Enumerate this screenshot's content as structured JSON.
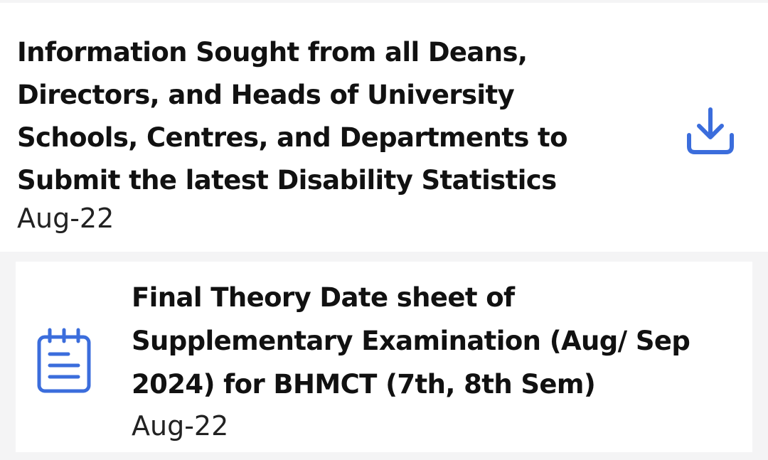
{
  "notices": [
    {
      "title": "Information Sought from all Deans, Directors, and Heads of University Schools, Centres, and Departments to Submit the latest Disability Statistics",
      "date": "Aug-22",
      "action_icon": "download-icon"
    },
    {
      "title": "Final Theory Date sheet of Supplementary Examination (Aug/ Sep 2024) for BHMCT (7th, 8th Sem)",
      "date": "Aug-22",
      "leading_icon": "notes-icon"
    }
  ],
  "colors": {
    "accent": "#3b6ddc",
    "background": "#f4f4f5",
    "card": "#ffffff",
    "text": "#111111"
  }
}
